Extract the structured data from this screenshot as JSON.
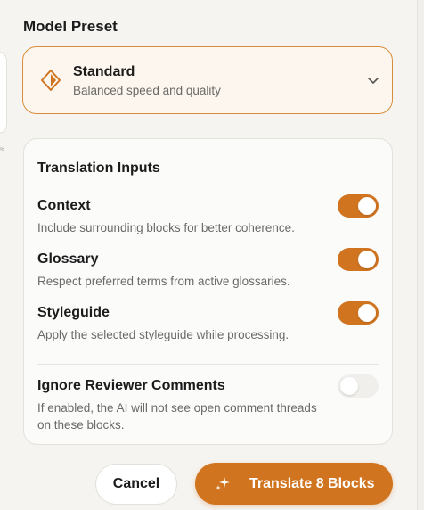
{
  "model_preset": {
    "section_title": "Model Preset",
    "selected": {
      "name": "Standard",
      "description": "Balanced speed and quality",
      "icon": "diamond-icon"
    },
    "accent": "#d07420"
  },
  "translation_inputs": {
    "title": "Translation Inputs",
    "items": [
      {
        "title": "Context",
        "description": "Include surrounding blocks for better coherence.",
        "enabled": true
      },
      {
        "title": "Glossary",
        "description": "Respect preferred terms from active glossaries.",
        "enabled": true
      },
      {
        "title": "Styleguide",
        "description": "Apply the selected styleguide while processing.",
        "enabled": true
      }
    ],
    "ignore_comments": {
      "title": "Ignore Reviewer Comments",
      "description": "If enabled, the AI will not see open comment threads on these blocks.",
      "enabled": false
    }
  },
  "actions": {
    "cancel_label": "Cancel",
    "translate_label": "Translate 8 Blocks",
    "translate_icon": "sparkle-icon"
  }
}
